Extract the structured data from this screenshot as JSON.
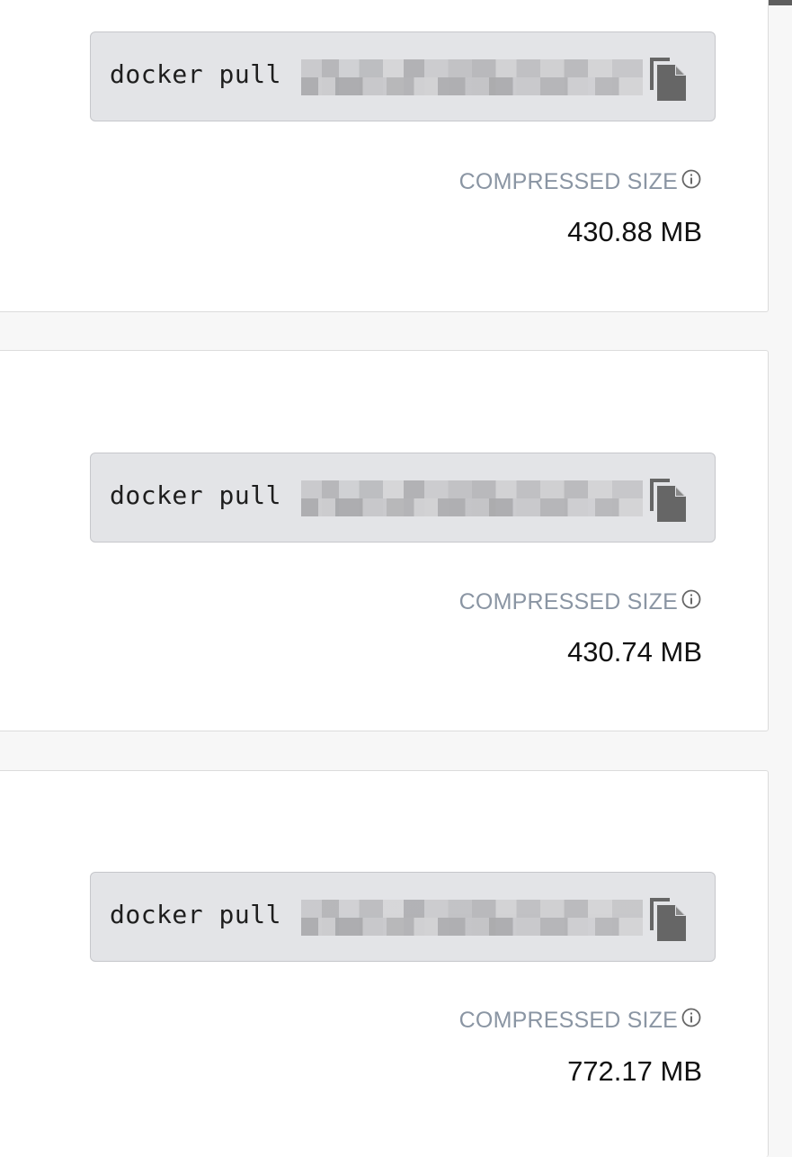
{
  "images": [
    {
      "command_prefix": "docker pull",
      "size_label": "COMPRESSED SIZE",
      "size_value": "430.88 MB"
    },
    {
      "command_prefix": "docker pull",
      "size_label": "COMPRESSED SIZE",
      "size_value": "430.74 MB"
    },
    {
      "command_prefix": "docker pull",
      "size_label": "COMPRESSED SIZE",
      "size_value": "772.17 MB"
    }
  ],
  "icons": {
    "copy": "copy-icon",
    "info": "info-icon"
  },
  "colors": {
    "page_background": "#f7f7f7",
    "card_background": "#ffffff",
    "command_box": "#e3e4e7",
    "label_gray": "#8a95a3",
    "icon_gray": "#666666"
  }
}
